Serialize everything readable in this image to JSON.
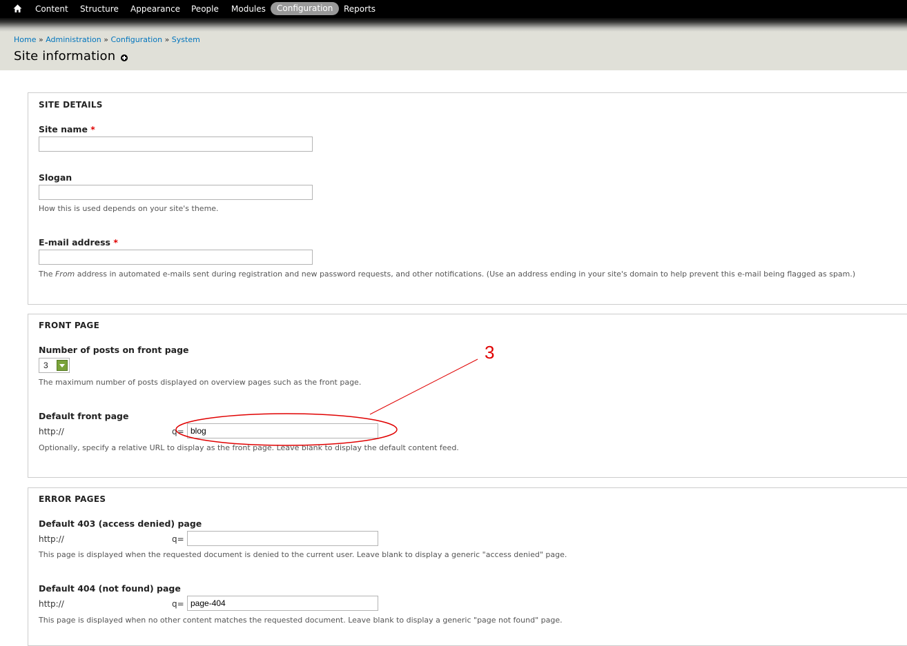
{
  "toolbar": {
    "home_icon": "home-icon",
    "items": [
      "Content",
      "Structure",
      "Appearance",
      "People",
      "Modules",
      "Configuration",
      "Reports"
    ],
    "active": "Configuration"
  },
  "breadcrumb": {
    "items": [
      "Home",
      "Administration",
      "Configuration",
      "System"
    ],
    "separator": "»"
  },
  "page": {
    "title": "Site information",
    "shortcut_icon": "add-shortcut-icon"
  },
  "site_details": {
    "legend": "SITE DETAILS",
    "site_name": {
      "label": "Site name",
      "required": "*",
      "value": ""
    },
    "slogan": {
      "label": "Slogan",
      "value": "",
      "description": "How this is used depends on your site's theme."
    },
    "email": {
      "label": "E-mail address",
      "required": "*",
      "value": "",
      "description_prefix": "The",
      "description_em": "From",
      "description_rest": "address in automated e-mails sent during registration and new password requests, and other notifications. (Use an address ending in your site's domain to help prevent this e-mail being flagged as spam.)"
    }
  },
  "front_page": {
    "legend": "FRONT PAGE",
    "posts": {
      "label": "Number of posts on front page",
      "value": "3",
      "description": "The maximum number of posts displayed on overview pages such as the front page."
    },
    "default_front": {
      "label": "Default front page",
      "prefix": "http://",
      "q": "q=",
      "value": "blog",
      "description": "Optionally, specify a relative URL to display as the front page. Leave blank to display the default content feed."
    }
  },
  "error_pages": {
    "legend": "ERROR PAGES",
    "page_403": {
      "label": "Default 403 (access denied) page",
      "prefix": "http://",
      "q": "q=",
      "value": "",
      "description": "This page is displayed when the requested document is denied to the current user. Leave blank to display a generic \"access denied\" page."
    },
    "page_404": {
      "label": "Default 404 (not found) page",
      "prefix": "http://",
      "q": "q=",
      "value": "page-404",
      "description": "This page is displayed when no other content matches the requested document. Leave blank to display a generic \"page not found\" page."
    }
  },
  "annotation": {
    "label": "3",
    "color": "#e00000"
  },
  "colors": {
    "toolbar_bg": "#000000",
    "header_bg": "#e0e0d8",
    "link": "#0074bd",
    "required": "#e00000",
    "select_arrow": "#7aa33a"
  }
}
